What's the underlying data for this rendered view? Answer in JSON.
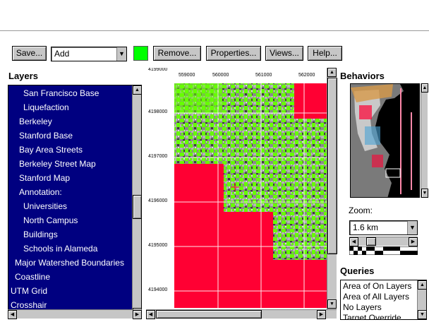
{
  "toolbar": {
    "save_label": "Save...",
    "add_select_value": "Add",
    "swatch_color": "#00ff00",
    "remove_label": "Remove...",
    "properties_label": "Properties...",
    "views_label": "Views...",
    "help_label": "Help..."
  },
  "layers": {
    "title": "Layers",
    "items": [
      {
        "label": "San Francisco Base"
      },
      {
        "label": "Liquefaction"
      },
      {
        "label": "Berkeley"
      },
      {
        "label": "Stanford Base"
      },
      {
        "label": "Bay Area Streets"
      },
      {
        "label": "Berkeley Street Map"
      },
      {
        "label": "Stanford Map"
      },
      {
        "label": "Annotation:"
      },
      {
        "label": "Universities"
      },
      {
        "label": "North Campus"
      },
      {
        "label": "Buildings"
      },
      {
        "label": "Schools in Alameda"
      },
      {
        "label": "Major Watershed Boundaries"
      },
      {
        "label": "Coastline"
      },
      {
        "label": "UTM Grid"
      },
      {
        "label": "Crosshair"
      }
    ]
  },
  "map": {
    "x_ticks": [
      "559000",
      "560000",
      "561000",
      "562000"
    ],
    "y_ticks": [
      "4199000",
      "4198000",
      "4197000",
      "4196000",
      "4195000",
      "4194000"
    ],
    "colors": {
      "hazard": "#ff0033",
      "overlay": "#66ff00",
      "terrain": "#808080"
    }
  },
  "behaviors": {
    "title": "Behaviors",
    "zoom_label": "Zoom:",
    "zoom_value": "1.6 km"
  },
  "queries": {
    "title": "Queries",
    "items": [
      "Area of On Layers",
      "Area of All Layers",
      "No Layers",
      "Target Override"
    ]
  }
}
